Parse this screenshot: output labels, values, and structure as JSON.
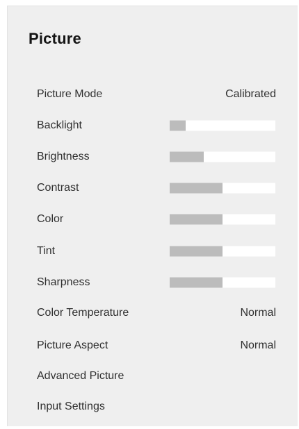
{
  "panel": {
    "title": "Picture",
    "items": [
      {
        "label": "Picture Mode",
        "value": "Calibrated"
      },
      {
        "label": "Backlight",
        "level": 0.15
      },
      {
        "label": "Brightness",
        "level": 0.32
      },
      {
        "label": "Contrast",
        "level": 0.5
      },
      {
        "label": "Color",
        "level": 0.5
      },
      {
        "label": "Tint",
        "level": 0.5
      },
      {
        "label": "Sharpness",
        "level": 0.5
      },
      {
        "label": "Color Temperature",
        "value": "Normal"
      },
      {
        "label": "Picture Aspect",
        "value": "Normal"
      },
      {
        "label": "Advanced Picture"
      },
      {
        "label": "Input Settings"
      }
    ]
  },
  "colors": {
    "panel_bg": "#efefef",
    "slider_track": "#ffffff",
    "slider_fill": "#bcbcbc"
  }
}
